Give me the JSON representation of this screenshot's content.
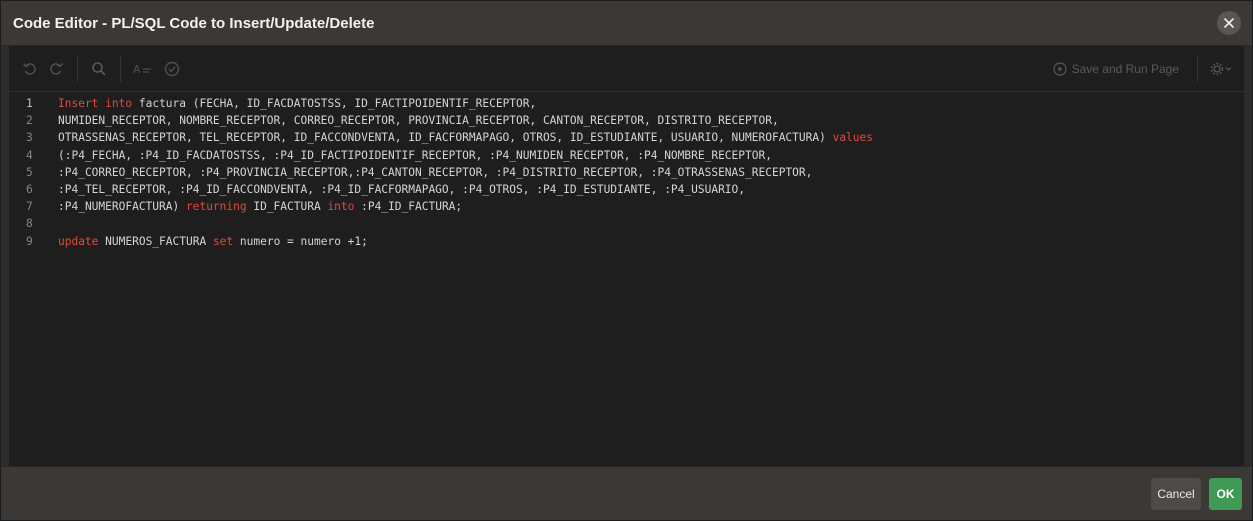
{
  "dialog": {
    "title": "Code Editor - PL/SQL Code to Insert/Update/Delete",
    "close_icon": "close-icon"
  },
  "toolbar": {
    "undo_icon": "undo-icon",
    "redo_icon": "redo-icon",
    "search_icon": "search-icon",
    "format_icon": "format-icon",
    "validate_icon": "validate-icon",
    "save_run_label": "Save and Run Page",
    "settings_icon": "gear-icon"
  },
  "editor": {
    "lines": [
      {
        "num": "1",
        "tokens": [
          {
            "t": "Insert",
            "k": true
          },
          {
            "t": " "
          },
          {
            "t": "into",
            "k": true
          },
          {
            "t": " factura (FECHA, ID_FACDATOSTSS, ID_FACTIPOIDENTIF_RECEPTOR,"
          }
        ]
      },
      {
        "num": "2",
        "tokens": [
          {
            "t": "NUMIDEN_RECEPTOR, NOMBRE_RECEPTOR, CORREO_RECEPTOR, PROVINCIA_RECEPTOR, CANTON_RECEPTOR, DISTRITO_RECEPTOR,"
          }
        ]
      },
      {
        "num": "3",
        "tokens": [
          {
            "t": "OTRASSENAS_RECEPTOR, TEL_RECEPTOR, ID_FACCONDVENTA, ID_FACFORMAPAGO, OTROS, ID_ESTUDIANTE, USUARIO, NUMEROFACTURA) "
          },
          {
            "t": "values",
            "k": true
          }
        ]
      },
      {
        "num": "4",
        "tokens": [
          {
            "t": "(:P4_FECHA, :P4_ID_FACDATOSTSS, :P4_ID_FACTIPOIDENTIF_RECEPTOR, :P4_NUMIDEN_RECEPTOR, :P4_NOMBRE_RECEPTOR,"
          }
        ]
      },
      {
        "num": "5",
        "tokens": [
          {
            "t": ":P4_CORREO_RECEPTOR, :P4_PROVINCIA_RECEPTOR,:P4_CANTON_RECEPTOR, :P4_DISTRITO_RECEPTOR, :P4_OTRASSENAS_RECEPTOR,"
          }
        ]
      },
      {
        "num": "6",
        "tokens": [
          {
            "t": ":P4_TEL_RECEPTOR, :P4_ID_FACCONDVENTA, :P4_ID_FACFORMAPAGO, :P4_OTROS, :P4_ID_ESTUDIANTE, :P4_USUARIO,"
          }
        ]
      },
      {
        "num": "7",
        "tokens": [
          {
            "t": ":P4_NUMEROFACTURA) "
          },
          {
            "t": "returning",
            "k": true
          },
          {
            "t": " ID_FACTURA "
          },
          {
            "t": "into",
            "k": true
          },
          {
            "t": " :P4_ID_FACTURA;"
          }
        ]
      },
      {
        "num": "8",
        "tokens": [
          {
            "t": ""
          }
        ]
      },
      {
        "num": "9",
        "tokens": [
          {
            "t": "update",
            "k": true
          },
          {
            "t": " NUMEROS_FACTURA "
          },
          {
            "t": "set",
            "k": true
          },
          {
            "t": " numero = numero +1;"
          }
        ]
      }
    ]
  },
  "footer": {
    "cancel_label": "Cancel",
    "ok_label": "OK"
  },
  "colors": {
    "keyword": "#e04a3f",
    "ok_button": "#3f9a55"
  }
}
